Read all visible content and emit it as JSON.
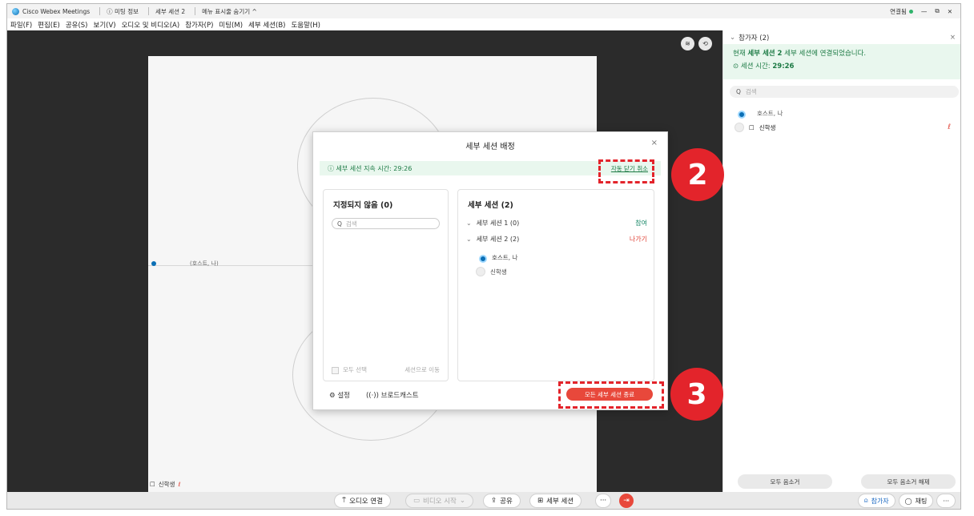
{
  "titlebar": {
    "app_name": "Cisco Webex Meetings",
    "meeting_info": "ⓘ 미팅 정보",
    "session": "세부 세션 2",
    "menu_toggle": "메뉴 표시줄 숨기기 ^",
    "status": "연결됨",
    "minimize": "—",
    "restore": "⧉",
    "close": "✕"
  },
  "menubar": {
    "items": [
      "파일(F)",
      "편집(E)",
      "공유(S)",
      "보기(V)",
      "오디오 및 비디오(A)",
      "참가자(P)",
      "미팅(M)",
      "세부 세션(B)",
      "도움말(H)"
    ]
  },
  "stage": {
    "host_label": "(호스트, 나)",
    "attendee_label": "신학생",
    "layout_icon": "layout-icon",
    "rotate_icon": "rotate-icon"
  },
  "bottombar": {
    "audio": "오디오 연결",
    "video": "비디오 시작",
    "share": "공유",
    "breakout": "세부 세션",
    "more": "···",
    "participants": "참가자",
    "chat": "채팅",
    "more_right": "···"
  },
  "panel": {
    "title": "참가자 (2)",
    "close": "×",
    "notice_prefix": "현재 ",
    "notice_bold": "세부 세션 2",
    "notice_suffix": " 세부 세션에 연결되었습니다.",
    "timer_label": "세션 시간: ",
    "timer_value": "29:26",
    "search_placeholder": "검색",
    "participants": [
      {
        "name": "호스트, 나"
      },
      {
        "name": "신학생"
      }
    ],
    "mute_all": "모두 음소거",
    "unmute_all": "모두 음소거 해제"
  },
  "modal": {
    "title": "세부 세션 배정",
    "close": "×",
    "duration_label": "ⓘ 세부 세션 지속 시간: 29:26",
    "auto_close_link": "자동 닫기 취소",
    "left_title": "지정되지 않음 (0)",
    "left_search": "검색",
    "select_all": "모두 선택",
    "move_to_session": "세션으로 이동",
    "right_title": "세부 세션 (2)",
    "sessions": [
      {
        "name": "세부 세션 1 (0)",
        "action": "참여",
        "action_color": "#1c8a6a"
      },
      {
        "name": "세부 세션 2 (2)",
        "action": "나가기",
        "action_color": "#e0453a"
      }
    ],
    "members": [
      {
        "name": "호스트, 나"
      },
      {
        "name": "신학생"
      }
    ],
    "settings": "설정",
    "broadcast": "브로드캐스트",
    "end_all": "모든 세부 세션 종료"
  },
  "annotations": {
    "badge2": "2",
    "badge3": "3",
    "color": "#e3242b"
  }
}
